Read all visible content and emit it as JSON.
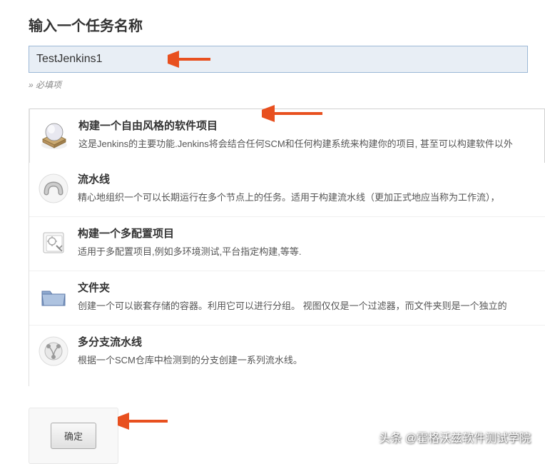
{
  "header": {
    "title": "输入一个任务名称",
    "input_value": "TestJenkins1",
    "required_hint": "» 必填项"
  },
  "item_types": [
    {
      "id": "freestyle",
      "title": "构建一个自由风格的软件项目",
      "desc": "这是Jenkins的主要功能.Jenkins将会结合任何SCM和任何构建系统来构建你的项目, 甚至可以构建软件以外",
      "selected": true
    },
    {
      "id": "pipeline",
      "title": "流水线",
      "desc": "精心地组织一个可以长期运行在多个节点上的任务。适用于构建流水线（更加正式地应当称为工作流），"
    },
    {
      "id": "multiconfig",
      "title": "构建一个多配置项目",
      "desc": "适用于多配置项目,例如多环境测试,平台指定构建,等等."
    },
    {
      "id": "folder",
      "title": "文件夹",
      "desc": "创建一个可以嵌套存储的容器。利用它可以进行分组。 视图仅仅是一个过滤器，而文件夹则是一个独立的"
    },
    {
      "id": "multibranch",
      "title": "多分支流水线",
      "desc": "根据一个SCM仓库中检测到的分支创建一系列流水线。"
    }
  ],
  "footer": {
    "ok_label": "确定"
  },
  "watermark": "头条 @霍格沃兹软件测试学院",
  "annotations": {
    "arrow_color": "#e8501f"
  }
}
